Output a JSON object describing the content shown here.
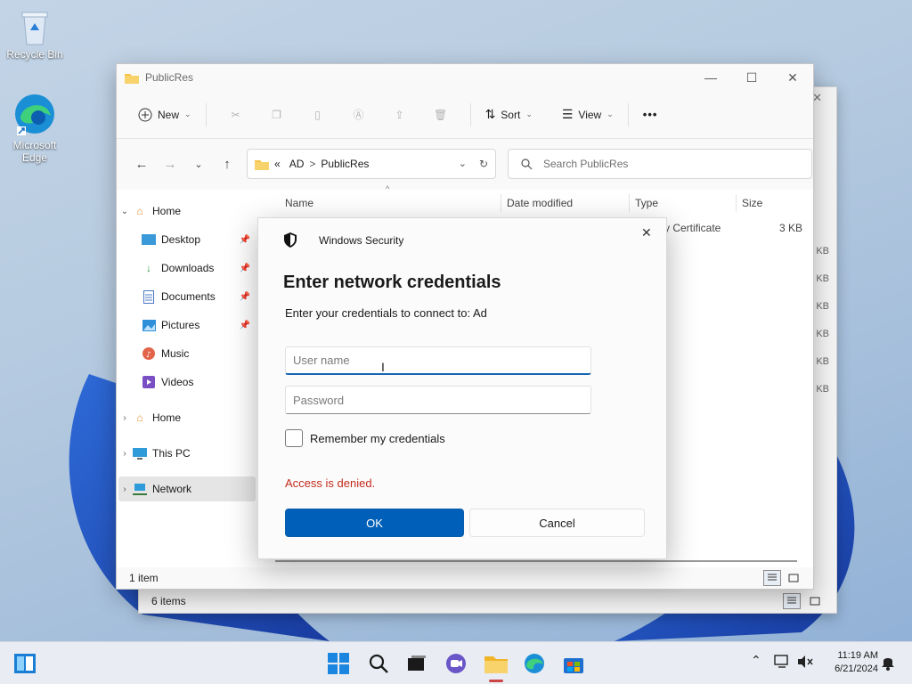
{
  "desktop": {
    "icons": [
      {
        "label": "Recycle Bin"
      },
      {
        "label": "Microsoft Edge"
      }
    ]
  },
  "back_window": {
    "status_items": "6 items",
    "size_suffix": "KB"
  },
  "explorer": {
    "title": "PublicRes",
    "toolbar": {
      "new_label": "New",
      "sort_label": "Sort",
      "view_label": "View",
      "more_label": "•••"
    },
    "address": {
      "prefix": "«",
      "parts": [
        "AD",
        "PublicRes"
      ],
      "separator": ">"
    },
    "search_placeholder": "Search PublicRes",
    "columns": {
      "name": "Name",
      "date": "Date modified",
      "type": "Type",
      "size": "Size"
    },
    "row": {
      "type": "y Certificate",
      "size": "3 KB"
    },
    "nav": [
      {
        "label": "Home"
      },
      {
        "label": "Desktop"
      },
      {
        "label": "Downloads"
      },
      {
        "label": "Documents"
      },
      {
        "label": "Pictures"
      },
      {
        "label": "Music"
      },
      {
        "label": "Videos"
      },
      {
        "label": "Home"
      },
      {
        "label": "This PC"
      },
      {
        "label": "Network"
      }
    ],
    "status": "1 item"
  },
  "dialog": {
    "app_name": "Windows Security",
    "title": "Enter network credentials",
    "subtitle": "Enter your credentials to connect to: Ad",
    "username_placeholder": "User name",
    "password_placeholder": "Password",
    "remember_label": "Remember my credentials",
    "error": "Access is denied.",
    "ok_label": "OK",
    "cancel_label": "Cancel",
    "colors": {
      "accent": "#005fb8",
      "error": "#c42b1c"
    }
  },
  "taskbar": {
    "time": "11:19 AM",
    "date": "6/21/2024"
  }
}
